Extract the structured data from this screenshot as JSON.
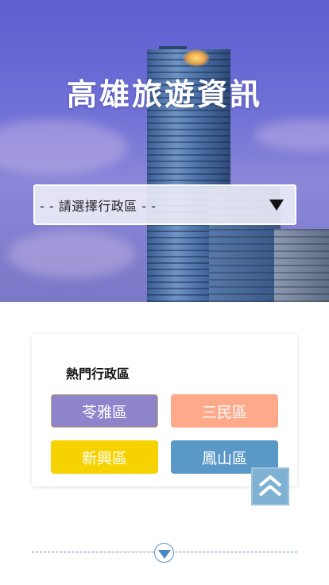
{
  "hero": {
    "title": "高雄旅遊資訊"
  },
  "district_select": {
    "selected": "- - 請選擇行政區 - -",
    "icon": "caret-down-icon"
  },
  "popular": {
    "title": "熱門行政區",
    "districts": [
      {
        "label": "苓雅區",
        "color": "#8d84cc"
      },
      {
        "label": "三民區",
        "color": "#fda98a"
      },
      {
        "label": "新興區",
        "color": "#f5d200"
      },
      {
        "label": "鳳山區",
        "color": "#5a98c8"
      }
    ]
  },
  "controls": {
    "back_to_top_icon": "double-chevron-up-icon",
    "scroll_down_icon": "triangle-down-icon"
  }
}
